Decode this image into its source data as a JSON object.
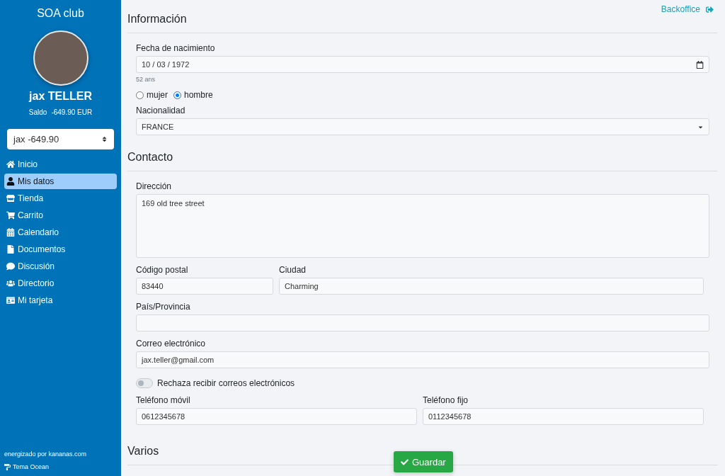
{
  "sidebar": {
    "title": "SOA club",
    "user_name": "jax TELLER",
    "balance_label": "Saldo",
    "balance_value": "-649.90 EUR",
    "account_select": "jax -649.90",
    "nav": [
      {
        "label": "Inicio",
        "selected": false
      },
      {
        "label": "Mis datos",
        "selected": true
      },
      {
        "label": "Tienda",
        "selected": false
      },
      {
        "label": "Carrito",
        "selected": false
      },
      {
        "label": "Calendario",
        "selected": false
      },
      {
        "label": "Documentos",
        "selected": false
      },
      {
        "label": "Discusión",
        "selected": false
      },
      {
        "label": "Directorio",
        "selected": false
      },
      {
        "label": "Mi tarjeta",
        "selected": false
      }
    ],
    "footer_text": "energizado por kananas.com",
    "theme_link": "Tema Ocean"
  },
  "backoffice_link": "Backoffice",
  "informacion": {
    "heading": "Información",
    "birth_date": {
      "label": "Fecha de nacimiento",
      "value": "10 / 03 / 1972",
      "hint": "52 ans"
    },
    "gender": [
      {
        "label": "mujer",
        "selected": false
      },
      {
        "label": "hombre",
        "selected": true
      }
    ],
    "nationality": {
      "label": "Nacionalidad",
      "value": "FRANCE"
    }
  },
  "contacto": {
    "heading": "Contacto",
    "address": {
      "label": "Dirección",
      "value": "169 old tree street"
    },
    "postal_code": {
      "label": "Código postal",
      "value": "83440"
    },
    "city": {
      "label": "Ciudad",
      "value": "Charming"
    },
    "region": {
      "label": "País/Provincia"
    },
    "email": {
      "label": "Correo electrónico",
      "value": "jax.teller@gmail.com"
    },
    "refuse_emails": {
      "label": "Rechaza recibir correos electrónicos",
      "on": false
    },
    "mobile": {
      "label": "Teléfono móvil",
      "value": "0612345678"
    },
    "landline": {
      "label": "Teléfono fijo",
      "value": "0112345678"
    }
  },
  "varios": {
    "heading": "Varios"
  },
  "save_button": "Guardar"
}
